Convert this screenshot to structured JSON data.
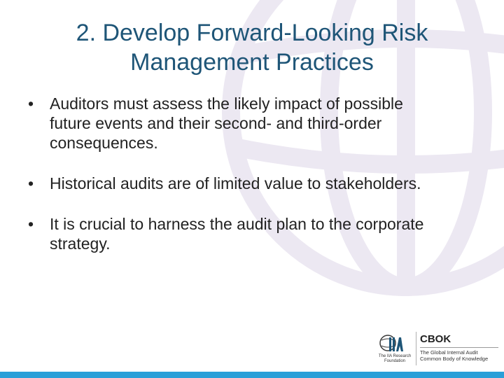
{
  "slide": {
    "title_line1": "2. Develop Forward-Looking Risk",
    "title_line2": "Management Practices",
    "bullet_symbol": "•",
    "bullets": [
      "Auditors must assess the likely impact of possible future events and their second- and third-order consequences.",
      "Historical audits are of limited value to stakeholders.",
      "It is crucial to harness the audit plan to the corporate strategy."
    ]
  },
  "footer": {
    "iia_caption_line1": "The IIA Research",
    "iia_caption_line2": "Foundation",
    "cbok_title": "CBOK",
    "cbok_sub_line1": "The Global Internal Audit",
    "cbok_sub_line2": "Common Body of Knowledge"
  },
  "colors": {
    "title": "#1e5577",
    "watermark": "#ece8f2",
    "bottom_bar": "#2a9fd8"
  },
  "icons": {
    "watermark": "globe-watermark-icon",
    "iia_logo": "iia-logo-icon"
  }
}
